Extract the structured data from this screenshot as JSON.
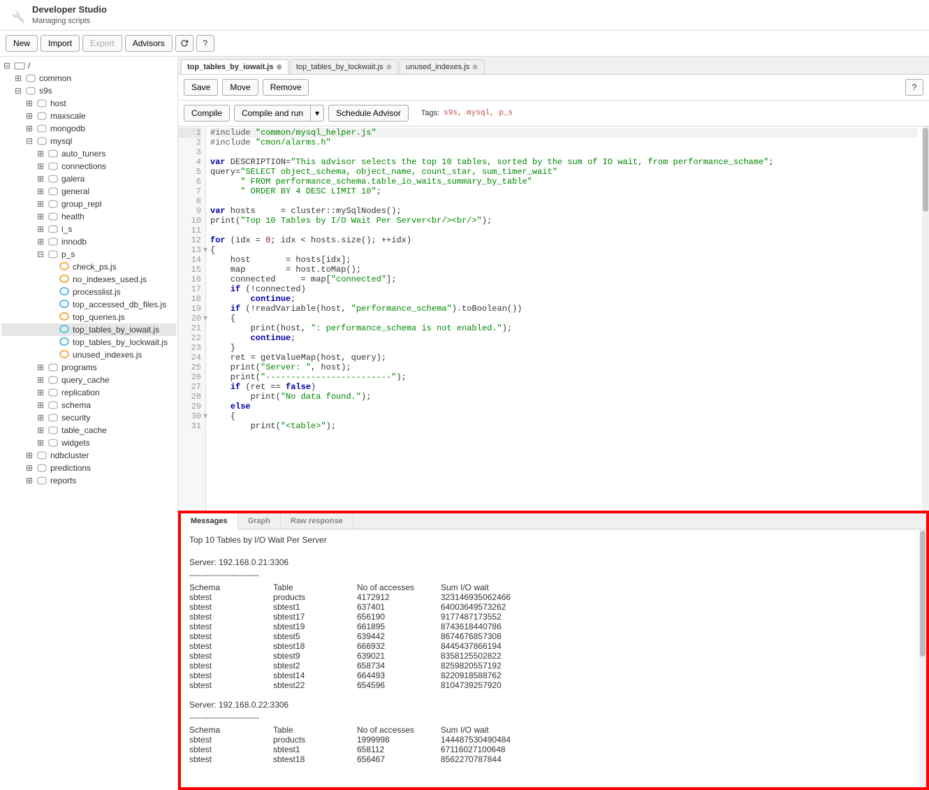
{
  "header": {
    "title": "Developer Studio",
    "subtitle": "Managing scripts"
  },
  "toolbar": {
    "new": "New",
    "import": "Import",
    "export": "Export",
    "advisors": "Advisors",
    "reload_tip": "Reload",
    "help_tip": "?"
  },
  "tree": {
    "root": "/",
    "nodes": [
      {
        "label": "common",
        "type": "folder",
        "indent": 1,
        "expanded": false
      },
      {
        "label": "s9s",
        "type": "folder",
        "indent": 1,
        "expanded": true
      },
      {
        "label": "host",
        "type": "folder",
        "indent": 2,
        "expanded": false
      },
      {
        "label": "maxscale",
        "type": "folder",
        "indent": 2,
        "expanded": false
      },
      {
        "label": "mongodb",
        "type": "folder",
        "indent": 2,
        "expanded": false
      },
      {
        "label": "mysql",
        "type": "folder",
        "indent": 2,
        "expanded": true
      },
      {
        "label": "auto_tuners",
        "type": "folder",
        "indent": 3,
        "expanded": false
      },
      {
        "label": "connections",
        "type": "folder",
        "indent": 3,
        "expanded": false
      },
      {
        "label": "galera",
        "type": "folder",
        "indent": 3,
        "expanded": false
      },
      {
        "label": "general",
        "type": "folder",
        "indent": 3,
        "expanded": false
      },
      {
        "label": "group_repl",
        "type": "folder",
        "indent": 3,
        "expanded": false
      },
      {
        "label": "health",
        "type": "folder",
        "indent": 3,
        "expanded": false
      },
      {
        "label": "i_s",
        "type": "folder",
        "indent": 3,
        "expanded": false
      },
      {
        "label": "innodb",
        "type": "folder",
        "indent": 3,
        "expanded": false
      },
      {
        "label": "p_s",
        "type": "folder",
        "indent": 3,
        "expanded": true
      },
      {
        "label": "check_ps.js",
        "type": "file",
        "indent": 4,
        "icon": "orange"
      },
      {
        "label": "no_indexes_used.js",
        "type": "file",
        "indent": 4,
        "icon": "orange"
      },
      {
        "label": "processlist.js",
        "type": "file",
        "indent": 4,
        "icon": "blue"
      },
      {
        "label": "top_accessed_db_files.js",
        "type": "file",
        "indent": 4,
        "icon": "blue"
      },
      {
        "label": "top_queries.js",
        "type": "file",
        "indent": 4,
        "icon": "orange"
      },
      {
        "label": "top_tables_by_iowait.js",
        "type": "file",
        "indent": 4,
        "icon": "blue",
        "selected": true
      },
      {
        "label": "top_tables_by_lockwait.js",
        "type": "file",
        "indent": 4,
        "icon": "blue"
      },
      {
        "label": "unused_indexes.js",
        "type": "file",
        "indent": 4,
        "icon": "orange"
      },
      {
        "label": "programs",
        "type": "folder",
        "indent": 3,
        "expanded": false
      },
      {
        "label": "query_cache",
        "type": "folder",
        "indent": 3,
        "expanded": false
      },
      {
        "label": "replication",
        "type": "folder",
        "indent": 3,
        "expanded": false
      },
      {
        "label": "schema",
        "type": "folder",
        "indent": 3,
        "expanded": false
      },
      {
        "label": "security",
        "type": "folder",
        "indent": 3,
        "expanded": false
      },
      {
        "label": "table_cache",
        "type": "folder",
        "indent": 3,
        "expanded": false
      },
      {
        "label": "widgets",
        "type": "folder",
        "indent": 3,
        "expanded": false
      },
      {
        "label": "ndbcluster",
        "type": "folder",
        "indent": 2,
        "expanded": false
      },
      {
        "label": "predictions",
        "type": "folder",
        "indent": 2,
        "expanded": false
      },
      {
        "label": "reports",
        "type": "folder",
        "indent": 2,
        "expanded": false
      }
    ]
  },
  "tabs": [
    {
      "label": "top_tables_by_iowait.js",
      "active": true,
      "closable": true
    },
    {
      "label": "top_tables_by_lockwait.js",
      "active": false,
      "closable": true
    },
    {
      "label": "unused_indexes.js",
      "active": false,
      "closable": true
    }
  ],
  "editor_toolbar": {
    "save": "Save",
    "move": "Move",
    "remove": "Remove",
    "help": "?"
  },
  "compile_toolbar": {
    "compile": "Compile",
    "compile_run": "Compile and run",
    "schedule": "Schedule Advisor",
    "tags_label": "Tags:",
    "tags_value": "s9s, mysql, p_s"
  },
  "code": {
    "current_line": 1,
    "lines": [
      {
        "n": 1,
        "t": [
          {
            "k": "prep",
            "v": "#include "
          },
          {
            "k": "str",
            "v": "\"common/mysql_helper.js\""
          }
        ]
      },
      {
        "n": 2,
        "t": [
          {
            "k": "prep",
            "v": "#include "
          },
          {
            "k": "str",
            "v": "\"cmon/alarms.h\""
          }
        ]
      },
      {
        "n": 3,
        "t": []
      },
      {
        "n": 4,
        "t": [
          {
            "k": "kw",
            "v": "var"
          },
          {
            "k": "id",
            "v": " DESCRIPTION="
          },
          {
            "k": "str",
            "v": "\"This advisor selects the top 10 tables, sorted by the sum of IO wait, from performance_schame\""
          },
          {
            "k": "punct",
            "v": ";"
          }
        ]
      },
      {
        "n": 5,
        "t": [
          {
            "k": "id",
            "v": "query="
          },
          {
            "k": "str",
            "v": "\"SELECT object_schema, object_name, count_star, sum_timer_wait\""
          }
        ]
      },
      {
        "n": 6,
        "t": [
          {
            "k": "id",
            "v": "      "
          },
          {
            "k": "str",
            "v": "\" FROM performance_schema.table_io_waits_summary_by_table\""
          }
        ]
      },
      {
        "n": 7,
        "t": [
          {
            "k": "id",
            "v": "      "
          },
          {
            "k": "str",
            "v": "\" ORDER BY 4 DESC LIMIT 10\""
          },
          {
            "k": "punct",
            "v": ";"
          }
        ]
      },
      {
        "n": 8,
        "t": []
      },
      {
        "n": 9,
        "t": [
          {
            "k": "kw",
            "v": "var"
          },
          {
            "k": "id",
            "v": " hosts     = cluster::mySqlNodes();"
          }
        ]
      },
      {
        "n": 10,
        "t": [
          {
            "k": "id",
            "v": "print("
          },
          {
            "k": "str",
            "v": "\"Top 10 Tables by I/O Wait Per Server<br/><br/>\""
          },
          {
            "k": "id",
            "v": ");"
          }
        ]
      },
      {
        "n": 11,
        "t": []
      },
      {
        "n": 12,
        "t": [
          {
            "k": "kw",
            "v": "for"
          },
          {
            "k": "id",
            "v": " (idx = "
          },
          {
            "k": "num",
            "v": "0"
          },
          {
            "k": "id",
            "v": "; idx < hosts.size(); ++idx)"
          }
        ]
      },
      {
        "n": 13,
        "fold": true,
        "t": [
          {
            "k": "punct",
            "v": "{"
          }
        ]
      },
      {
        "n": 14,
        "t": [
          {
            "k": "id",
            "v": "    host       = hosts[idx];"
          }
        ]
      },
      {
        "n": 15,
        "t": [
          {
            "k": "id",
            "v": "    map        = host.toMap();"
          }
        ]
      },
      {
        "n": 16,
        "t": [
          {
            "k": "id",
            "v": "    connected     = map["
          },
          {
            "k": "str",
            "v": "\"connected\""
          },
          {
            "k": "id",
            "v": "];"
          }
        ]
      },
      {
        "n": 17,
        "t": [
          {
            "k": "id",
            "v": "    "
          },
          {
            "k": "kw",
            "v": "if"
          },
          {
            "k": "id",
            "v": " (!connected)"
          }
        ]
      },
      {
        "n": 18,
        "t": [
          {
            "k": "id",
            "v": "        "
          },
          {
            "k": "kw",
            "v": "continue"
          },
          {
            "k": "punct",
            "v": ";"
          }
        ]
      },
      {
        "n": 19,
        "t": [
          {
            "k": "id",
            "v": "    "
          },
          {
            "k": "kw",
            "v": "if"
          },
          {
            "k": "id",
            "v": " (!readVariable(host, "
          },
          {
            "k": "str",
            "v": "\"performance_schema\""
          },
          {
            "k": "id",
            "v": ").toBoolean())"
          }
        ]
      },
      {
        "n": 20,
        "fold": true,
        "t": [
          {
            "k": "id",
            "v": "    "
          },
          {
            "k": "punct",
            "v": "{"
          }
        ]
      },
      {
        "n": 21,
        "t": [
          {
            "k": "id",
            "v": "        print(host, "
          },
          {
            "k": "str",
            "v": "\": performance_schema is not enabled.\""
          },
          {
            "k": "id",
            "v": ");"
          }
        ]
      },
      {
        "n": 22,
        "t": [
          {
            "k": "id",
            "v": "        "
          },
          {
            "k": "kw",
            "v": "continue"
          },
          {
            "k": "punct",
            "v": ";"
          }
        ]
      },
      {
        "n": 23,
        "t": [
          {
            "k": "id",
            "v": "    "
          },
          {
            "k": "punct",
            "v": "}"
          }
        ]
      },
      {
        "n": 24,
        "t": [
          {
            "k": "id",
            "v": "    ret = getValueMap(host, query);"
          }
        ]
      },
      {
        "n": 25,
        "t": [
          {
            "k": "id",
            "v": "    print("
          },
          {
            "k": "str",
            "v": "\"Server: \""
          },
          {
            "k": "id",
            "v": ", host);"
          }
        ]
      },
      {
        "n": 26,
        "t": [
          {
            "k": "id",
            "v": "    print("
          },
          {
            "k": "str",
            "v": "\"-------------------------\""
          },
          {
            "k": "id",
            "v": ");"
          }
        ]
      },
      {
        "n": 27,
        "t": [
          {
            "k": "id",
            "v": "    "
          },
          {
            "k": "kw",
            "v": "if"
          },
          {
            "k": "id",
            "v": " (ret == "
          },
          {
            "k": "kw",
            "v": "false"
          },
          {
            "k": "id",
            "v": ")"
          }
        ]
      },
      {
        "n": 28,
        "t": [
          {
            "k": "id",
            "v": "        print("
          },
          {
            "k": "str",
            "v": "\"No data found.\""
          },
          {
            "k": "id",
            "v": ");"
          }
        ]
      },
      {
        "n": 29,
        "t": [
          {
            "k": "id",
            "v": "    "
          },
          {
            "k": "kw",
            "v": "else"
          }
        ]
      },
      {
        "n": 30,
        "fold": true,
        "t": [
          {
            "k": "id",
            "v": "    "
          },
          {
            "k": "punct",
            "v": "{"
          }
        ]
      },
      {
        "n": 31,
        "t": [
          {
            "k": "id",
            "v": "        print("
          },
          {
            "k": "str",
            "v": "\"<table>\""
          },
          {
            "k": "id",
            "v": ");"
          }
        ]
      }
    ]
  },
  "output_tabs": {
    "messages": "Messages",
    "graph": "Graph",
    "raw": "Raw response"
  },
  "output": {
    "title": "Top 10 Tables by I/O Wait Per Server",
    "columns": [
      "Schema",
      "Table",
      "No of accesses",
      "Sum I/O wait"
    ],
    "divider": "-------------------------",
    "servers": [
      {
        "label": "Server: 192.168.0.21:3306",
        "rows": [
          [
            "sbtest",
            "products",
            "4172912",
            "323146935062466"
          ],
          [
            "sbtest",
            "sbtest1",
            "637401",
            "64003649573262"
          ],
          [
            "sbtest",
            "sbtest17",
            "656190",
            "9177487173552"
          ],
          [
            "sbtest",
            "sbtest19",
            "661895",
            "8743618440786"
          ],
          [
            "sbtest",
            "sbtest5",
            "639442",
            "8674676857308"
          ],
          [
            "sbtest",
            "sbtest18",
            "666932",
            "8445437866194"
          ],
          [
            "sbtest",
            "sbtest9",
            "639021",
            "8358125502822"
          ],
          [
            "sbtest",
            "sbtest2",
            "658734",
            "8259820557192"
          ],
          [
            "sbtest",
            "sbtest14",
            "664493",
            "8220918588762"
          ],
          [
            "sbtest",
            "sbtest22",
            "654596",
            "8104739257920"
          ]
        ]
      },
      {
        "label": "Server: 192.168.0.22:3306",
        "rows": [
          [
            "sbtest",
            "products",
            "1999998",
            "144487530490484"
          ],
          [
            "sbtest",
            "sbtest1",
            "658112",
            "67116027100648"
          ],
          [
            "sbtest",
            "sbtest18",
            "656467",
            "8562270787844"
          ]
        ]
      }
    ]
  }
}
